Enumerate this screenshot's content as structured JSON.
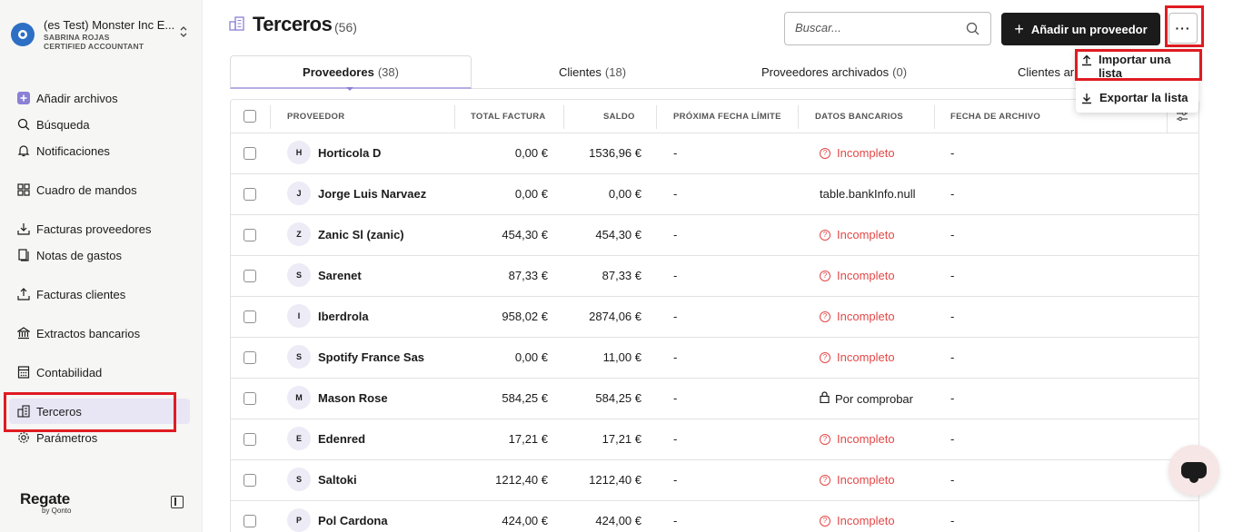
{
  "org": {
    "name": "(es Test) Monster Inc E...",
    "user": "SABRINA ROJAS",
    "role": "CERTIFIED ACCOUNTANT"
  },
  "sidebar": {
    "items": [
      {
        "label": "Añadir archivos",
        "icon": "plus-square-icon"
      },
      {
        "label": "Búsqueda",
        "icon": "search-icon"
      },
      {
        "label": "Notificaciones",
        "icon": "bell-icon"
      },
      {
        "label": "Cuadro de mandos",
        "icon": "dashboard-icon"
      },
      {
        "label": "Facturas proveedores",
        "icon": "download-tray-icon"
      },
      {
        "label": "Notas de gastos",
        "icon": "receipt-icon"
      },
      {
        "label": "Facturas clientes",
        "icon": "upload-tray-icon"
      },
      {
        "label": "Extractos bancarios",
        "icon": "bank-icon"
      },
      {
        "label": "Contabilidad",
        "icon": "calculator-icon"
      },
      {
        "label": "Terceros",
        "icon": "buildings-icon",
        "active": true
      },
      {
        "label": "Parámetros",
        "icon": "gear-icon"
      }
    ]
  },
  "brand": {
    "name": "Regate",
    "sub": "by Qonto"
  },
  "header": {
    "title": "Terceros",
    "count": "(56)",
    "search_placeholder": "Buscar...",
    "add_label": "Añadir un proveedor",
    "more_label": "···"
  },
  "tabs": [
    {
      "label": "Proveedores",
      "count": "(38)",
      "active": true
    },
    {
      "label": "Clientes",
      "count": "(18)"
    },
    {
      "label": "Proveedores archivados",
      "count": "(0)"
    },
    {
      "label": "Clientes ar",
      "count": ""
    }
  ],
  "table": {
    "columns": [
      "PROVEEDOR",
      "TOTAL FACTURA",
      "SALDO",
      "PRÓXIMA FECHA LÍMITE",
      "DATOS BANCARIOS",
      "FECHA DE ARCHIVO"
    ],
    "rows": [
      {
        "initial": "H",
        "name": "Horticola D",
        "total": "0,00 €",
        "saldo": "1536,96 €",
        "fecha": "-",
        "banco": "Incompleto",
        "banco_status": "warn",
        "archivo": "-"
      },
      {
        "initial": "J",
        "name": "Jorge Luis Narvaez",
        "total": "0,00 €",
        "saldo": "0,00 €",
        "fecha": "-",
        "banco": "table.bankInfo.null",
        "banco_status": "plain",
        "archivo": "-"
      },
      {
        "initial": "Z",
        "name": "Zanic Sl (zanic)",
        "total": "454,30 €",
        "saldo": "454,30 €",
        "fecha": "-",
        "banco": "Incompleto",
        "banco_status": "warn",
        "archivo": "-"
      },
      {
        "initial": "S",
        "name": "Sarenet",
        "total": "87,33 €",
        "saldo": "87,33 €",
        "fecha": "-",
        "banco": "Incompleto",
        "banco_status": "warn",
        "archivo": "-"
      },
      {
        "initial": "I",
        "name": "Iberdrola",
        "total": "958,02 €",
        "saldo": "2874,06 €",
        "fecha": "-",
        "banco": "Incompleto",
        "banco_status": "warn",
        "archivo": "-"
      },
      {
        "initial": "S",
        "name": "Spotify France Sas",
        "total": "0,00 €",
        "saldo": "11,00 €",
        "fecha": "-",
        "banco": "Incompleto",
        "banco_status": "warn",
        "archivo": "-"
      },
      {
        "initial": "M",
        "name": "Mason Rose",
        "total": "584,25 €",
        "saldo": "584,25 €",
        "fecha": "-",
        "banco": "Por comprobar",
        "banco_status": "lock",
        "archivo": "-"
      },
      {
        "initial": "E",
        "name": "Edenred",
        "total": "17,21 €",
        "saldo": "17,21 €",
        "fecha": "-",
        "banco": "Incompleto",
        "banco_status": "warn",
        "archivo": "-"
      },
      {
        "initial": "S",
        "name": "Saltoki",
        "total": "1212,40 €",
        "saldo": "1212,40 €",
        "fecha": "-",
        "banco": "Incompleto",
        "banco_status": "warn",
        "archivo": "-"
      },
      {
        "initial": "P",
        "name": "Pol Cardona",
        "total": "424,00 €",
        "saldo": "424,00 €",
        "fecha": "-",
        "banco": "Incompleto",
        "banco_status": "warn",
        "archivo": "-"
      }
    ]
  },
  "dropdown": {
    "import_label": "Importar una lista",
    "export_label": "Exportar la lista"
  },
  "colors": {
    "accent": "#8a80d6",
    "warning": "#e34848",
    "highlight": "#e01b22",
    "primary_button": "#1b1b1b"
  }
}
